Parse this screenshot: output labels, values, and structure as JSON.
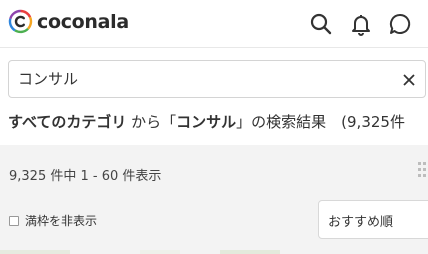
{
  "header": {
    "logo_text": "coconala",
    "icons": [
      "search-icon",
      "bell-icon",
      "chat-icon"
    ]
  },
  "search": {
    "value": "コンサル",
    "placeholder": ""
  },
  "results": {
    "prefix_bold": "すべてのカテゴリ",
    "from_text": " から「",
    "keyword_bold": "コンサル",
    "suffix": "」の検索結果　(9,325件",
    "count_text": "9,325 件中 1 - 60 件表示"
  },
  "filters": {
    "checkbox_label": "満枠を非表示",
    "sort_selected": "おすすめ順"
  },
  "colors": {
    "band_bg": "#f3f3f3",
    "logo_ring": [
      "#e83e3e",
      "#f5a623",
      "#4caf50",
      "#2e86de",
      "#8e44ad"
    ]
  }
}
